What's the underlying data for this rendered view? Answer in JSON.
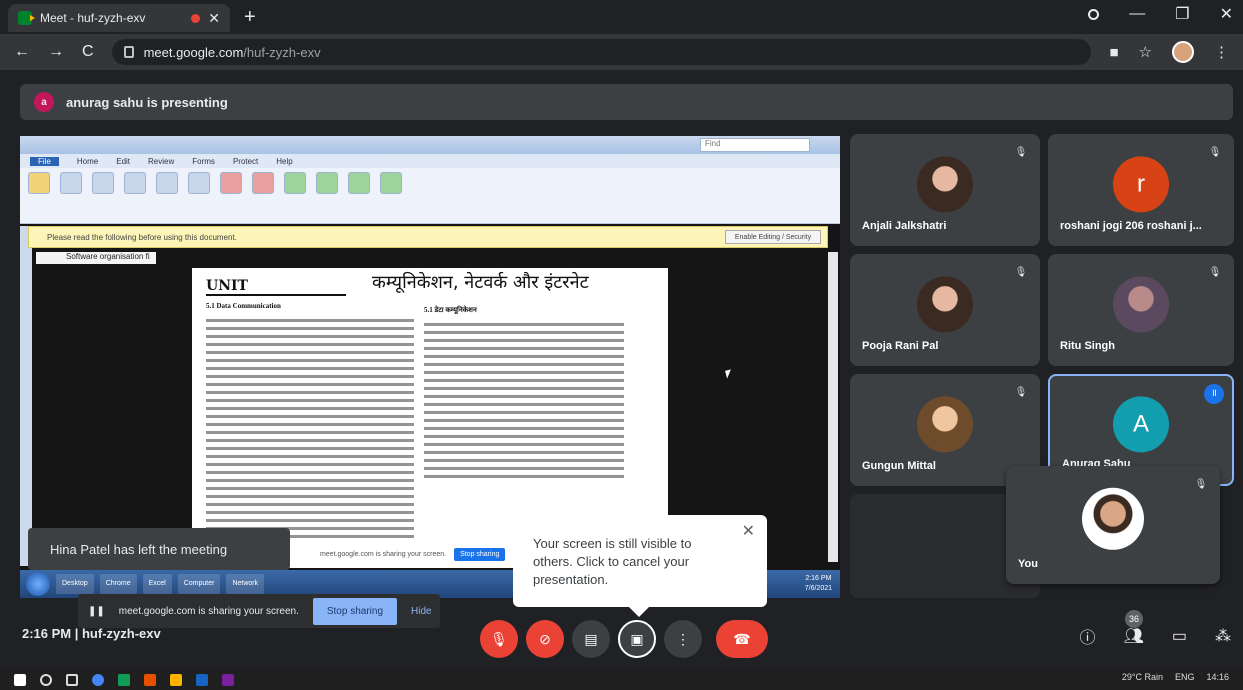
{
  "browser": {
    "tab_title": "Meet - huf-zyzh-exv",
    "url_host": "meet.google.com",
    "url_path": "/huf-zyzh-exv"
  },
  "presenting": {
    "avatar_letter": "a",
    "text": "anurag sahu is presenting"
  },
  "shared_screen": {
    "ribbon_tabs": [
      "File",
      "Home",
      "Edit",
      "Review",
      "Forms",
      "Protect",
      "Help"
    ],
    "find_placeholder": "Find",
    "infobar_text": "Please read the following before using this document.",
    "infobar_button": "Enable Editing / Security",
    "doc_tab": "Software organisation fi",
    "doc_unit": "UNIT",
    "doc_heading": "कम्यूनिकेशन, नेटवर्क और इंटरनेट",
    "doc_section_en": "5.1 Data Communication",
    "doc_section_hi": "5.1 डेटा कम्यूनिकेशन",
    "mini_share_text": "meet.google.com is sharing your screen.",
    "mini_stop": "Stop sharing",
    "tb_items": [
      "Desktop",
      "Chrome",
      "Excel",
      "Computer",
      "Network"
    ],
    "tb_time": "2:16 PM",
    "tb_date": "7/6/2021"
  },
  "participants": [
    {
      "name": "Anjali Jalkshatri",
      "type": "photo"
    },
    {
      "name": "roshani jogi 206 roshani j...",
      "type": "letter",
      "letter": "r",
      "color": "#d84315"
    },
    {
      "name": "Pooja Rani Pal",
      "type": "photo"
    },
    {
      "name": "Ritu Singh",
      "type": "photo"
    },
    {
      "name": "Gungun Mittal",
      "type": "photo"
    },
    {
      "name": "Anurag Sahu",
      "type": "letter",
      "letter": "A",
      "color": "#129eaf"
    },
    {
      "name": "You",
      "type": "photo"
    }
  ],
  "toasts": {
    "left_meeting": "Hina Patel has left the meeting",
    "popup": "Your screen is still visible to others. Click to cancel your presentation.",
    "sharing_text": "meet.google.com is sharing your screen.",
    "stop_sharing": "Stop sharing",
    "hide": "Hide"
  },
  "meeting": {
    "time_code": "2:16 PM | huf-zyzh-exv",
    "participant_count": "36"
  },
  "taskbar": {
    "weather": "29°C Rain",
    "lang": "ENG",
    "time": "14:16"
  }
}
